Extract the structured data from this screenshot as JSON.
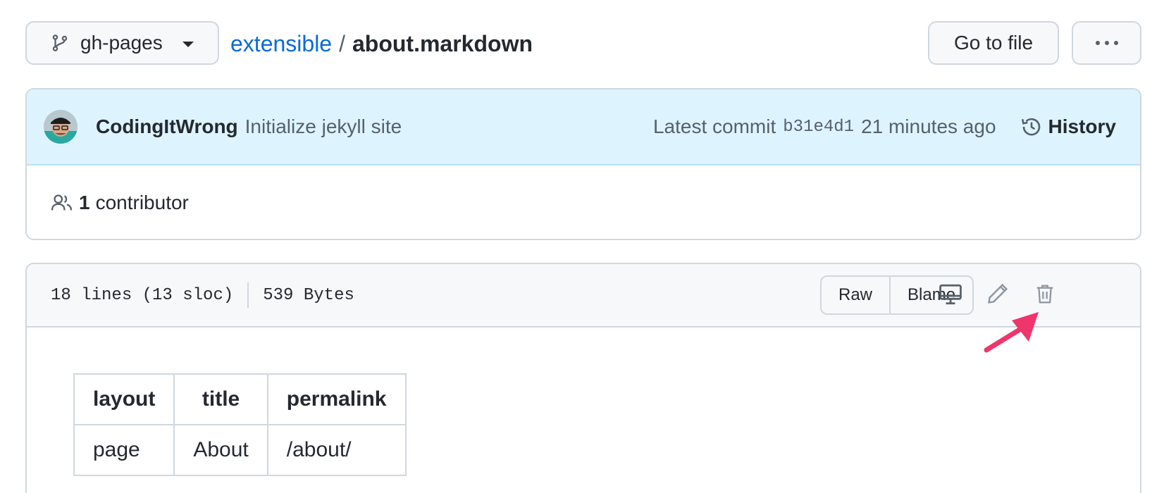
{
  "branch": {
    "name": "gh-pages",
    "icon": "git-branch-icon"
  },
  "breadcrumb": {
    "repo": "extensible",
    "separator": "/",
    "file": "about.markdown"
  },
  "actions": {
    "go_to_file": "Go to file",
    "more_icon": "kebab-horizontal-icon"
  },
  "commit": {
    "author": "CodingItWrong",
    "message": "Initialize jekyll site",
    "latest_label": "Latest commit",
    "sha": "b31e4d1",
    "time": "21 minutes ago",
    "history_label": "History",
    "history_icon": "history-icon"
  },
  "contributors": {
    "count": "1",
    "label": "contributor",
    "icon": "people-icon"
  },
  "file": {
    "lines": "18 lines (13 sloc)",
    "size": "539 Bytes",
    "raw_label": "Raw",
    "blame_label": "Blame",
    "icons": [
      "desktop-icon",
      "pencil-icon",
      "trash-icon"
    ]
  },
  "front_matter": {
    "headers": [
      "layout",
      "title",
      "permalink"
    ],
    "row": [
      "page",
      "About",
      "/about/"
    ]
  },
  "colors": {
    "link": "#0969da",
    "commit_bg": "#ddf4ff",
    "annotation_arrow": "#f0346c"
  }
}
